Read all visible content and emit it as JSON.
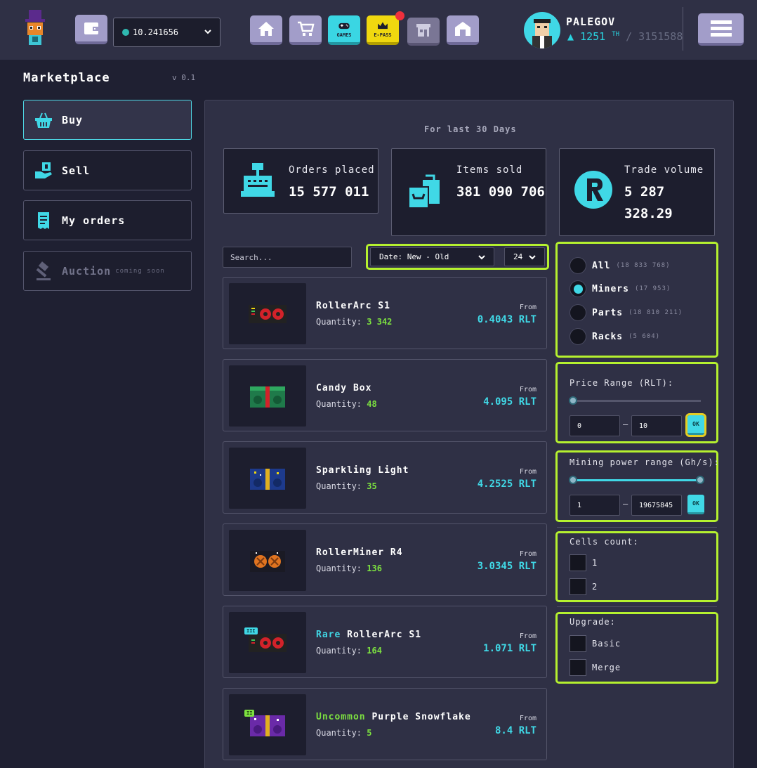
{
  "header": {
    "wallet_balance": "10.241656",
    "nav_labels": {
      "games": "GAMES",
      "epass": "E-PASS"
    },
    "username": "PALEGOV",
    "power_value": "1251",
    "power_unit": "TH",
    "power_total": "/ 3151588"
  },
  "sidebar": {
    "title": "Marketplace",
    "version": "v 0.1",
    "items": [
      {
        "label": "Buy",
        "icon": "basket-icon",
        "state": "active"
      },
      {
        "label": "Sell",
        "icon": "hand-money-icon",
        "state": "normal"
      },
      {
        "label": "My orders",
        "icon": "receipt-icon",
        "state": "normal"
      },
      {
        "label": "Auction",
        "icon": "gavel-icon",
        "state": "disabled",
        "note": "coming soon"
      }
    ]
  },
  "stats": {
    "period": "For last 30 Days",
    "orders": {
      "label": "Orders placed",
      "value": "15 577 011"
    },
    "items": {
      "label": "Items sold",
      "value": "381 090 706"
    },
    "volume": {
      "label": "Trade volume",
      "value": "5 287 328.29"
    }
  },
  "filters": {
    "search_placeholder": "Search...",
    "sort": "Date: New - Old",
    "per_page": "24",
    "categories": [
      {
        "label": "All",
        "count": "(18 833 768)",
        "selected": false
      },
      {
        "label": "Miners",
        "count": "(17 953)",
        "selected": true
      },
      {
        "label": "Parts",
        "count": "(18 810 211)",
        "selected": false
      },
      {
        "label": "Racks",
        "count": "(5 604)",
        "selected": false
      }
    ],
    "price": {
      "title": "Price Range (RLT):",
      "min": "0",
      "max": "10",
      "ok": "OK"
    },
    "power": {
      "title": "Mining power range (Gh/s):",
      "min": "1",
      "max": "19675845",
      "ok": "OK"
    },
    "cells": {
      "title": "Cells count:",
      "options": [
        "1",
        "2"
      ]
    },
    "upgrade": {
      "title": "Upgrade:",
      "options": [
        "Basic",
        "Merge"
      ]
    }
  },
  "items": [
    {
      "rarity": "",
      "name": "RollerArc S1",
      "qty_label": "Quantity:",
      "qty": "3 342",
      "from": "From",
      "price": "0.4043 RLT"
    },
    {
      "rarity": "",
      "name": "Candy Box",
      "qty_label": "Quantity:",
      "qty": "48",
      "from": "From",
      "price": "4.095 RLT"
    },
    {
      "rarity": "",
      "name": "Sparkling Light",
      "qty_label": "Quantity:",
      "qty": "35",
      "from": "From",
      "price": "4.2525 RLT"
    },
    {
      "rarity": "",
      "name": "RollerMiner R4",
      "qty_label": "Quantity:",
      "qty": "136",
      "from": "From",
      "price": "3.0345 RLT"
    },
    {
      "rarity": "Rare",
      "name": "RollerArc S1",
      "qty_label": "Quantity:",
      "qty": "164",
      "from": "From",
      "price": "1.071 RLT",
      "badge": "III"
    },
    {
      "rarity": "Uncommon",
      "name": "Purple Snowflake",
      "qty_label": "Quantity:",
      "qty": "5",
      "from": "From",
      "price": "8.4 RLT",
      "badge": "II"
    }
  ],
  "colors": {
    "accent": "#40d8e6",
    "highlight": "#b5f12f",
    "quantity": "#7ce040",
    "rare": "#40d8e6",
    "uncommon": "#7ce040"
  }
}
